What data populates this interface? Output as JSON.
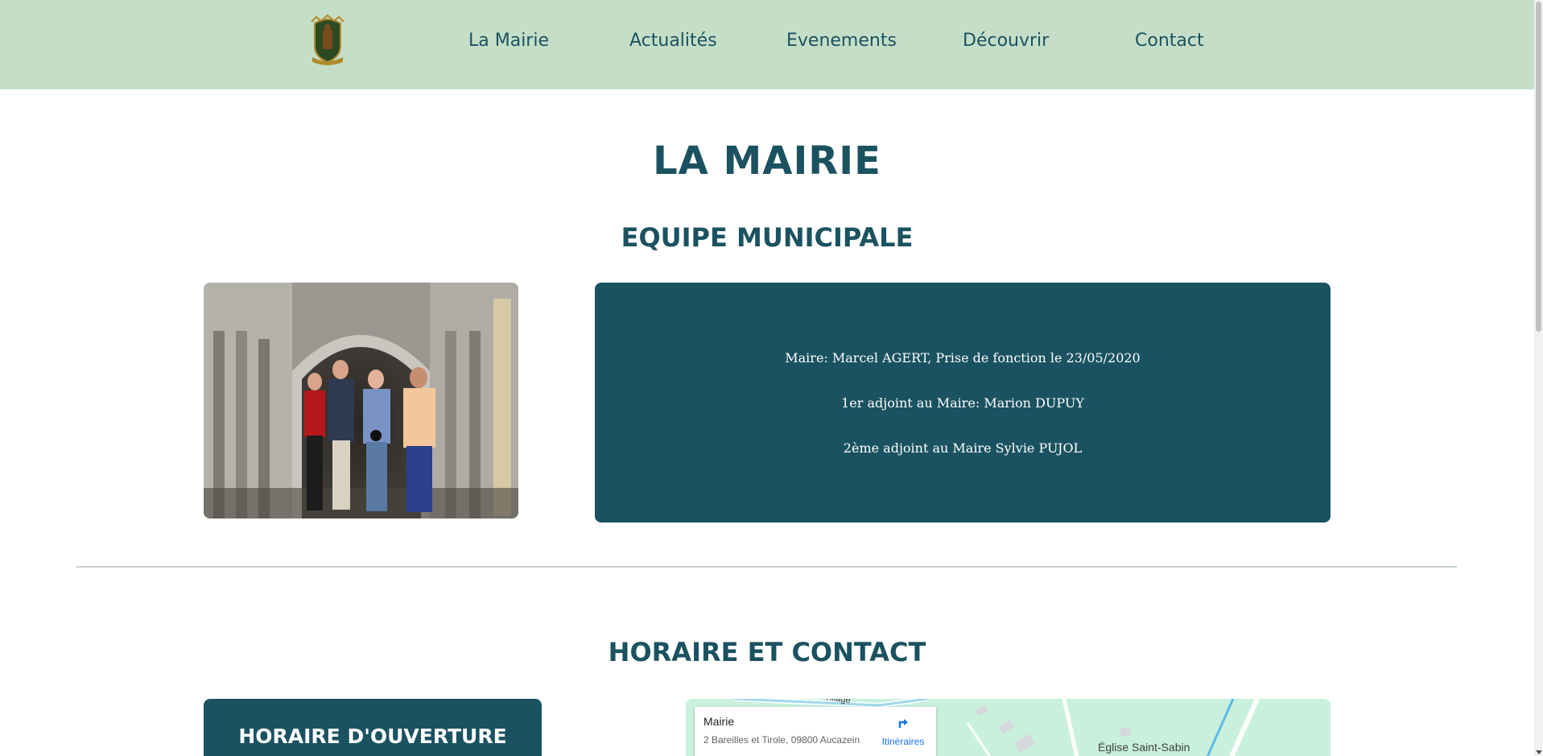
{
  "nav": {
    "logo_alt": "Blason de la commune",
    "items": [
      {
        "label": "La Mairie"
      },
      {
        "label": "Actualités"
      },
      {
        "label": "Evenements"
      },
      {
        "label": "Découvrir"
      },
      {
        "label": "Contact"
      }
    ]
  },
  "page": {
    "title": "LA MAIRIE"
  },
  "team": {
    "title": "EQUIPE MUNICIPALE",
    "members": [
      "Maire: Marcel AGERT, Prise de fonction le 23/05/2020",
      "1er adjoint au Maire: Marion DUPUY",
      "2ème adjoint au Maire Sylvie PUJOL"
    ]
  },
  "contact": {
    "title": "HORAIRE ET CONTACT",
    "hours_title": "HORAIRE D'OUVERTURE"
  },
  "map": {
    "place_name": "Mairie",
    "address": "2 Bareilles et Tirole, 09800 Aucazein",
    "directions_label": "Itinéraires",
    "poi_label": "Église Saint-Sabin",
    "road_label": "Village"
  },
  "colors": {
    "header_bg": "#c5dec8",
    "primary": "#1a5261",
    "map_link": "#1a73e8"
  }
}
